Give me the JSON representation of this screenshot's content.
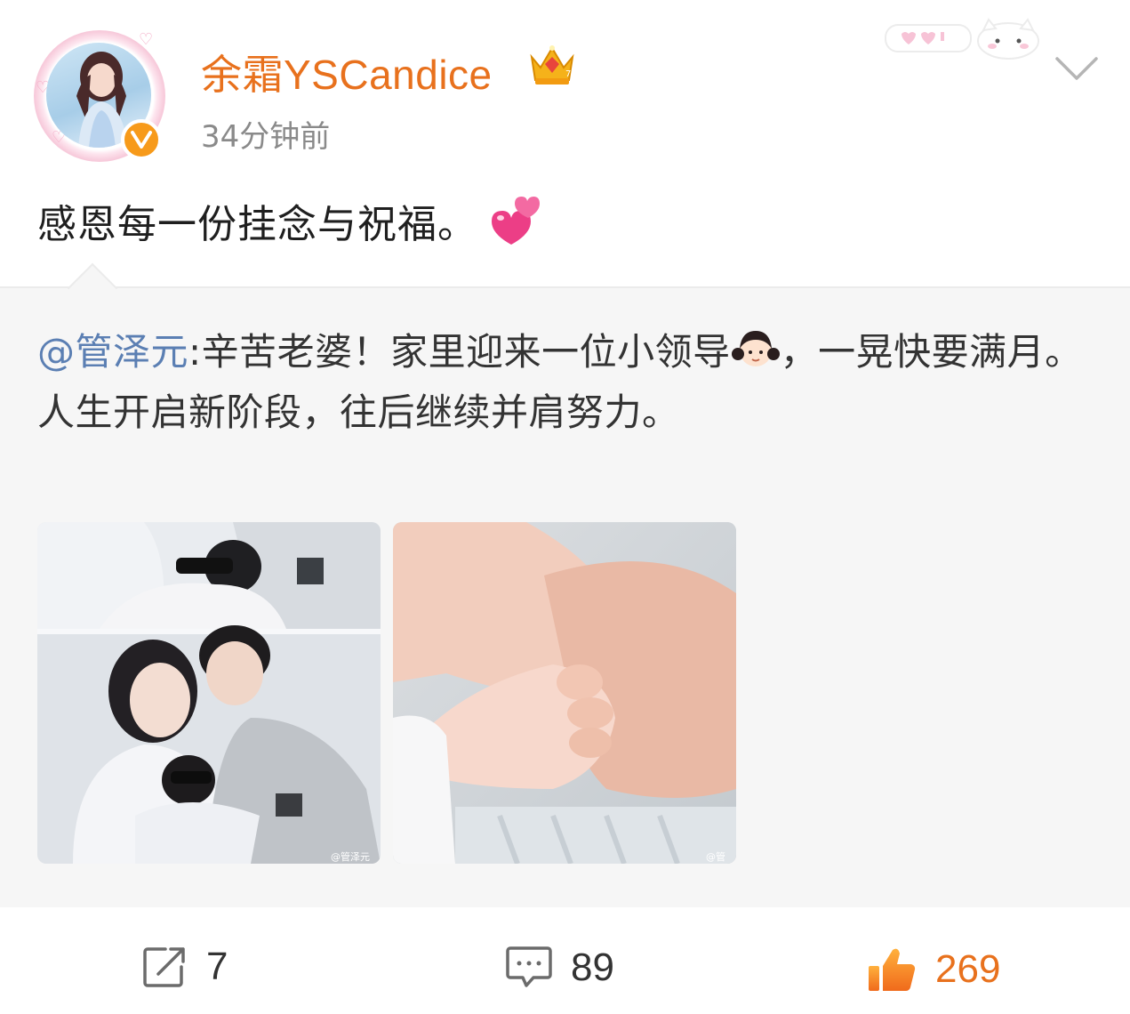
{
  "post": {
    "author": "余霜YSCandice",
    "time": "34分钟前",
    "text": "感恩每一份挂念与祝福。"
  },
  "repost": {
    "mention": "@管泽元",
    "text_part1": ":辛苦老婆！家里迎来一位小领导",
    "text_part2": "，一晃快要满月。",
    "text_line2": "人生开启新阶段，往后继续并肩努力。",
    "photos": [
      {
        "description": "family-photo",
        "watermark": "@管泽元"
      },
      {
        "description": "baby-hand-photo",
        "watermark": "@管"
      }
    ]
  },
  "actions": {
    "repost_count": "7",
    "comment_count": "89",
    "like_count": "269"
  },
  "colors": {
    "username": "#e8711d",
    "mention": "#5b7fb3",
    "repost_bg": "#f6f6f6",
    "verified": "#f79a1a"
  }
}
